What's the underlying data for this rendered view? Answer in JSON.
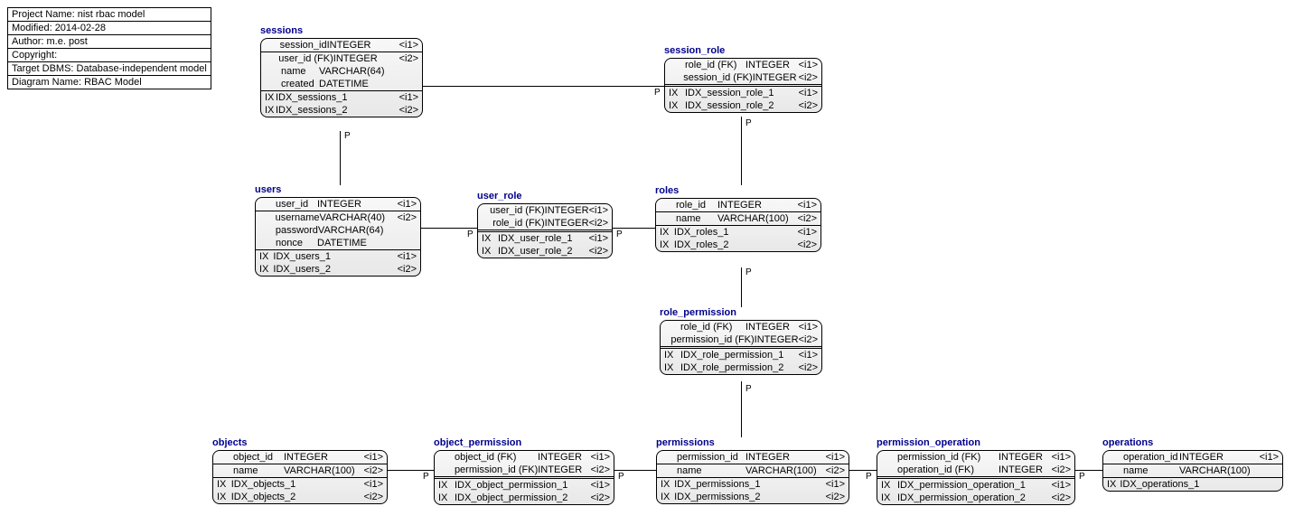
{
  "meta": {
    "project": "Project Name: nist rbac model",
    "modified": "Modified: 2014-02-28",
    "author": "Author: m.e. post",
    "copyright": "Copyright:",
    "target": "Target DBMS: Database-independent model",
    "diagram": "Diagram Name: RBAC Model"
  },
  "tags": {
    "i1": "<i1>",
    "i2": "<i2>"
  },
  "labels": {
    "IX": "IX",
    "P": "P"
  },
  "entities": {
    "sessions": {
      "title": "sessions",
      "pk": {
        "name": "session_id",
        "type": "INTEGER",
        "tag": "<i1>"
      },
      "cols": [
        {
          "name": "user_id (FK)",
          "type": "INTEGER",
          "tag": "<i2>"
        },
        {
          "name": "name",
          "type": "VARCHAR(64)",
          "tag": ""
        },
        {
          "name": "created",
          "type": "DATETIME",
          "tag": ""
        }
      ],
      "idx": [
        {
          "name": "IDX_sessions_1",
          "tag": "<i1>"
        },
        {
          "name": "IDX_sessions_2",
          "tag": "<i2>"
        }
      ]
    },
    "session_role": {
      "title": "session_role",
      "pk": [
        {
          "name": "role_id (FK)",
          "type": "INTEGER",
          "tag": "<i1>"
        },
        {
          "name": "session_id (FK)",
          "type": "INTEGER",
          "tag": "<i2>"
        }
      ],
      "idx": [
        {
          "name": "IDX_session_role_1",
          "tag": "<i1>"
        },
        {
          "name": "IDX_session_role_2",
          "tag": "<i2>"
        }
      ]
    },
    "users": {
      "title": "users",
      "pk": {
        "name": "user_id",
        "type": "INTEGER",
        "tag": "<i1>"
      },
      "cols": [
        {
          "name": "username",
          "type": "VARCHAR(40)",
          "tag": "<i2>"
        },
        {
          "name": "password",
          "type": "VARCHAR(64)",
          "tag": ""
        },
        {
          "name": "nonce",
          "type": "DATETIME",
          "tag": ""
        }
      ],
      "idx": [
        {
          "name": "IDX_users_1",
          "tag": "<i1>"
        },
        {
          "name": "IDX_users_2",
          "tag": "<i2>"
        }
      ]
    },
    "user_role": {
      "title": "user_role",
      "pk": [
        {
          "name": "user_id (FK)",
          "type": "INTEGER",
          "tag": "<i1>"
        },
        {
          "name": "role_id (FK)",
          "type": "INTEGER",
          "tag": "<i2>"
        }
      ],
      "idx": [
        {
          "name": "IDX_user_role_1",
          "tag": "<i1>"
        },
        {
          "name": "IDX_user_role_2",
          "tag": "<i2>"
        }
      ]
    },
    "roles": {
      "title": "roles",
      "pk": {
        "name": "role_id",
        "type": "INTEGER",
        "tag": "<i1>"
      },
      "cols": [
        {
          "name": "name",
          "type": "VARCHAR(100)",
          "tag": "<i2>"
        }
      ],
      "idx": [
        {
          "name": "IDX_roles_1",
          "tag": "<i1>"
        },
        {
          "name": "IDX_roles_2",
          "tag": "<i2>"
        }
      ]
    },
    "role_permission": {
      "title": "role_permission",
      "pk": [
        {
          "name": "role_id (FK)",
          "type": "INTEGER",
          "tag": "<i1>"
        },
        {
          "name": "permission_id (FK)",
          "type": "INTEGER",
          "tag": "<i2>"
        }
      ],
      "idx": [
        {
          "name": "IDX_role_permission_1",
          "tag": "<i1>"
        },
        {
          "name": "IDX_role_permission_2",
          "tag": "<i2>"
        }
      ]
    },
    "objects": {
      "title": "objects",
      "pk": {
        "name": "object_id",
        "type": "INTEGER",
        "tag": "<i1>"
      },
      "cols": [
        {
          "name": "name",
          "type": "VARCHAR(100)",
          "tag": "<i2>"
        }
      ],
      "idx": [
        {
          "name": "IDX_objects_1",
          "tag": "<i1>"
        },
        {
          "name": "IDX_objects_2",
          "tag": "<i2>"
        }
      ]
    },
    "object_permission": {
      "title": "object_permission",
      "pk": [
        {
          "name": "object_id (FK)",
          "type": "INTEGER",
          "tag": "<i1>"
        },
        {
          "name": "permission_id (FK)",
          "type": "INTEGER",
          "tag": "<i2>"
        }
      ],
      "idx": [
        {
          "name": "IDX_object_permission_1",
          "tag": "<i1>"
        },
        {
          "name": "IDX_object_permission_2",
          "tag": "<i2>"
        }
      ]
    },
    "permissions": {
      "title": "permissions",
      "pk": {
        "name": "permission_id",
        "type": "INTEGER",
        "tag": "<i1>"
      },
      "cols": [
        {
          "name": "name",
          "type": "VARCHAR(100)",
          "tag": "<i2>"
        }
      ],
      "idx": [
        {
          "name": "IDX_permissions_1",
          "tag": "<i1>"
        },
        {
          "name": "IDX_permissions_2",
          "tag": "<i2>"
        }
      ]
    },
    "permission_operation": {
      "title": "permission_operation",
      "pk": [
        {
          "name": "permission_id (FK)",
          "type": "INTEGER",
          "tag": "<i1>"
        },
        {
          "name": "operation_id (FK)",
          "type": "INTEGER",
          "tag": "<i2>"
        }
      ],
      "idx": [
        {
          "name": "IDX_permission_operation_1",
          "tag": "<i1>"
        },
        {
          "name": "IDX_permission_operation_2",
          "tag": "<i2>"
        }
      ]
    },
    "operations": {
      "title": "operations",
      "pk": {
        "name": "operation_id",
        "type": "INTEGER",
        "tag": "<i1>"
      },
      "cols": [
        {
          "name": "name",
          "type": "VARCHAR(100)",
          "tag": ""
        }
      ],
      "idx": [
        {
          "name": "IDX_operations_1",
          "tag": ""
        }
      ]
    }
  }
}
